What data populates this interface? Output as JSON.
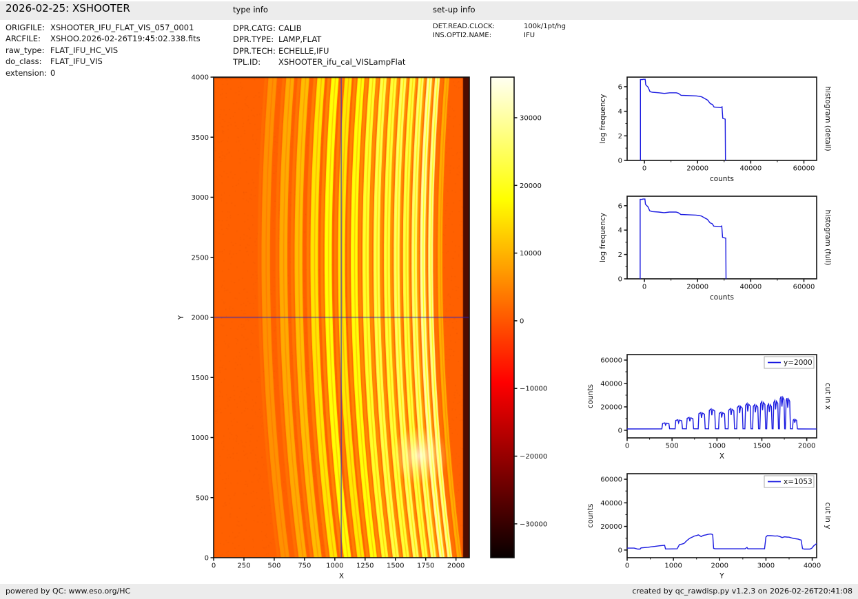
{
  "header": {
    "title": "2026-02-25: XSHOOTER",
    "type_info_title": "type info",
    "setup_info_title": "set-up info"
  },
  "file_info": {
    "rows": [
      {
        "label": "ORIGFILE:",
        "value": "XSHOOTER_IFU_FLAT_VIS_057_0001"
      },
      {
        "label": "ARCFILE:",
        "value": "XSHOO.2026-02-26T19:45:02.338.fits"
      },
      {
        "label": "raw_type:",
        "value": "FLAT_IFU_HC_VIS"
      },
      {
        "label": "do_class:",
        "value": "FLAT_IFU_VIS"
      },
      {
        "label": "extension:",
        "value": "0"
      }
    ]
  },
  "type_info": {
    "rows": [
      {
        "label": "DPR.CATG:",
        "value": "CALIB"
      },
      {
        "label": "DPR.TYPE:",
        "value": "LAMP,FLAT"
      },
      {
        "label": "DPR.TECH:",
        "value": "ECHELLE,IFU"
      },
      {
        "label": "TPL.ID:",
        "value": "XSHOOTER_ifu_cal_VISLampFlat"
      }
    ]
  },
  "setup_info": {
    "rows": [
      {
        "label": "DET.READ.CLOCK:",
        "value": "100k/1pt/hg"
      },
      {
        "label": "INS.OPTI2.NAME:",
        "value": "IFU"
      }
    ]
  },
  "footer": {
    "left": "powered by QC: www.eso.org/HC",
    "right": "created by qc_rawdisp.py v1.2.3 on 2026-02-26T20:41:08"
  },
  "colors": {
    "curve": "#1a1ae0",
    "crosshair": "#2020cc",
    "spine": "#111111",
    "bar_bg": "#ececec",
    "legend_edge": "#aaaaaa"
  },
  "chart_data": [
    {
      "id": "image",
      "type": "heatmap",
      "xlabel": "X",
      "ylabel": "Y",
      "xlim": [
        0,
        2110
      ],
      "ylim": [
        0,
        4000
      ],
      "xticks": [
        0,
        250,
        500,
        750,
        1000,
        1250,
        1500,
        1750,
        2000
      ],
      "yticks": [
        0,
        500,
        1000,
        1500,
        2000,
        2500,
        3000,
        3500,
        4000
      ],
      "crosshair": {
        "x": 1053,
        "y": 2000
      },
      "background_counts": 1100,
      "colormap": "hot",
      "vmin": -35000,
      "vmax": 36000,
      "curvature": {
        "vertex_y": 2500,
        "amplitude": 160
      },
      "orders": [
        {
          "x": 430,
          "peak": 6300,
          "hw": 38
        },
        {
          "x": 575,
          "peak": 9000,
          "hw": 36
        },
        {
          "x": 700,
          "peak": 11000,
          "hw": 35
        },
        {
          "x": 830,
          "peak": 15200,
          "hw": 34
        },
        {
          "x": 945,
          "peak": 18300,
          "hw": 33
        },
        {
          "x": 1055,
          "peak": 15500,
          "hw": 32
        },
        {
          "x": 1160,
          "peak": 18500,
          "hw": 31
        },
        {
          "x": 1255,
          "peak": 21000,
          "hw": 30
        },
        {
          "x": 1345,
          "peak": 23000,
          "hw": 29
        },
        {
          "x": 1430,
          "peak": 22000,
          "hw": 28
        },
        {
          "x": 1510,
          "peak": 24500,
          "hw": 27
        },
        {
          "x": 1585,
          "peak": 22500,
          "hw": 26
        },
        {
          "x": 1655,
          "peak": 25500,
          "hw": 25
        },
        {
          "x": 1725,
          "peak": 29000,
          "hw": 24
        },
        {
          "x": 1790,
          "peak": 27500,
          "hw": 23
        },
        {
          "x": 1868,
          "peak": 9400,
          "hw": 22
        }
      ],
      "edge_strip": {
        "x0": 2058,
        "x1": 2110
      },
      "bright_spot": {
        "x": 1700,
        "y": 850
      }
    },
    {
      "id": "cbar",
      "type": "colorbar",
      "colormap": "hot",
      "vmin": -35000,
      "vmax": 36000,
      "ticks": [
        30000,
        20000,
        10000,
        0,
        -10000,
        -20000,
        -30000
      ],
      "tick_labels": [
        "30000",
        "20000",
        "10000",
        "0",
        "−10000",
        "−20000",
        "−30000"
      ]
    },
    {
      "id": "hist1",
      "type": "line",
      "rlabel": "histogram (detail)",
      "xlabel": "counts",
      "ylabel": "log frequency",
      "xlim": [
        -6500,
        64800
      ],
      "ylim": [
        0,
        6.78
      ],
      "xticks": [
        0,
        20000,
        40000,
        60000
      ],
      "xminors": [
        10000,
        30000,
        50000
      ],
      "yticks": [
        0,
        2,
        4,
        6
      ],
      "yminors": [
        1,
        3,
        5
      ],
      "points": [
        [
          -1500,
          0
        ],
        [
          -1500,
          6.58
        ],
        [
          -700,
          6.58
        ],
        [
          -500,
          6.6
        ],
        [
          300,
          6.6
        ],
        [
          500,
          6.15
        ],
        [
          1400,
          5.95
        ],
        [
          2100,
          5.6
        ],
        [
          3000,
          5.55
        ],
        [
          5500,
          5.5
        ],
        [
          7500,
          5.45
        ],
        [
          9500,
          5.5
        ],
        [
          12000,
          5.5
        ],
        [
          12800,
          5.45
        ],
        [
          13800,
          5.3
        ],
        [
          16500,
          5.28
        ],
        [
          19500,
          5.25
        ],
        [
          20500,
          5.22
        ],
        [
          21500,
          5.18
        ],
        [
          22800,
          5.02
        ],
        [
          23800,
          4.9
        ],
        [
          24800,
          4.62
        ],
        [
          25600,
          4.55
        ],
        [
          26200,
          4.35
        ],
        [
          28700,
          4.3
        ],
        [
          29200,
          4.36
        ],
        [
          29500,
          3.42
        ],
        [
          30400,
          3.36
        ],
        [
          30500,
          0
        ]
      ]
    },
    {
      "id": "hist2",
      "type": "line",
      "rlabel": "histogram (full)",
      "xlabel": "counts",
      "ylabel": "log frequency",
      "xlim": [
        -6500,
        64800
      ],
      "ylim": [
        0,
        6.78
      ],
      "xticks": [
        0,
        20000,
        40000,
        60000
      ],
      "xminors": [
        10000,
        30000,
        50000
      ],
      "yticks": [
        0,
        2,
        4,
        6
      ],
      "yminors": [
        1,
        3,
        5
      ],
      "points": [
        [
          -1600,
          0
        ],
        [
          -1600,
          6.52
        ],
        [
          -800,
          6.52
        ],
        [
          -600,
          6.55
        ],
        [
          200,
          6.55
        ],
        [
          400,
          6.12
        ],
        [
          1300,
          5.92
        ],
        [
          2000,
          5.58
        ],
        [
          2900,
          5.52
        ],
        [
          5400,
          5.48
        ],
        [
          7400,
          5.43
        ],
        [
          9400,
          5.48
        ],
        [
          11900,
          5.48
        ],
        [
          12700,
          5.43
        ],
        [
          13700,
          5.28
        ],
        [
          16400,
          5.26
        ],
        [
          19400,
          5.23
        ],
        [
          20400,
          5.2
        ],
        [
          21400,
          5.16
        ],
        [
          22700,
          5.0
        ],
        [
          23700,
          4.88
        ],
        [
          24700,
          4.6
        ],
        [
          25500,
          4.53
        ],
        [
          26100,
          4.33
        ],
        [
          28600,
          4.28
        ],
        [
          29100,
          4.34
        ],
        [
          29400,
          3.4
        ],
        [
          30600,
          3.34
        ],
        [
          30700,
          0
        ]
      ]
    },
    {
      "id": "cutx",
      "type": "line",
      "rlabel": "cut in x",
      "xlabel": "X",
      "ylabel": "counts",
      "legend": "y=2000",
      "xlim": [
        0,
        2110
      ],
      "ylim": [
        -6500,
        64700
      ],
      "xticks": [
        0,
        500,
        1000,
        1500,
        2000
      ],
      "xminors": [
        250,
        750,
        1250,
        1750
      ],
      "yticks": [
        0,
        20000,
        40000,
        60000
      ],
      "yminors": [
        10000,
        30000,
        50000
      ],
      "points": [
        [
          0,
          1150
        ],
        [
          386,
          1200
        ],
        [
          387,
          1250
        ],
        [
          395,
          5860
        ],
        [
          420,
          6300
        ],
        [
          428,
          4410
        ],
        [
          438,
          6110
        ],
        [
          465,
          5670
        ],
        [
          473,
          1300
        ],
        [
          534,
          1250
        ],
        [
          542,
          8370
        ],
        [
          565,
          9000
        ],
        [
          573,
          6300
        ],
        [
          583,
          8730
        ],
        [
          608,
          8100
        ],
        [
          616,
          1300
        ],
        [
          660,
          1250
        ],
        [
          668,
          10230
        ],
        [
          690,
          11000
        ],
        [
          698,
          7700
        ],
        [
          708,
          10670
        ],
        [
          732,
          9900
        ],
        [
          740,
          1300
        ],
        [
          791,
          1250
        ],
        [
          799,
          14140
        ],
        [
          820,
          15200
        ],
        [
          828,
          10640
        ],
        [
          838,
          14740
        ],
        [
          861,
          13680
        ],
        [
          869,
          1300
        ],
        [
          907,
          1250
        ],
        [
          915,
          17020
        ],
        [
          935,
          18300
        ],
        [
          943,
          12810
        ],
        [
          953,
          17750
        ],
        [
          975,
          16470
        ],
        [
          983,
          1300
        ],
        [
          1018,
          1250
        ],
        [
          1026,
          14420
        ],
        [
          1045,
          15500
        ],
        [
          1053,
          10850
        ],
        [
          1063,
          15040
        ],
        [
          1084,
          13950
        ],
        [
          1092,
          1300
        ],
        [
          1124,
          1250
        ],
        [
          1132,
          17210
        ],
        [
          1150,
          18500
        ],
        [
          1158,
          12950
        ],
        [
          1168,
          17950
        ],
        [
          1188,
          16650
        ],
        [
          1196,
          1300
        ],
        [
          1220,
          1250
        ],
        [
          1228,
          19530
        ],
        [
          1245,
          21000
        ],
        [
          1253,
          14700
        ],
        [
          1263,
          20370
        ],
        [
          1282,
          18900
        ],
        [
          1290,
          1300
        ],
        [
          1311,
          1250
        ],
        [
          1319,
          21390
        ],
        [
          1335,
          23000
        ],
        [
          1343,
          16100
        ],
        [
          1353,
          22310
        ],
        [
          1371,
          20700
        ],
        [
          1379,
          1300
        ],
        [
          1397,
          1250
        ],
        [
          1405,
          20460
        ],
        [
          1420,
          22000
        ],
        [
          1428,
          15400
        ],
        [
          1438,
          21340
        ],
        [
          1455,
          19800
        ],
        [
          1463,
          1300
        ],
        [
          1478,
          1250
        ],
        [
          1486,
          22790
        ],
        [
          1500,
          24500
        ],
        [
          1508,
          17150
        ],
        [
          1518,
          23770
        ],
        [
          1534,
          22050
        ],
        [
          1542,
          1300
        ],
        [
          1554,
          1250
        ],
        [
          1562,
          20930
        ],
        [
          1575,
          22500
        ],
        [
          1583,
          15750
        ],
        [
          1593,
          21830
        ],
        [
          1606,
          20250
        ],
        [
          1614,
          1300
        ],
        [
          1625,
          1250
        ],
        [
          1633,
          23720
        ],
        [
          1645,
          25500
        ],
        [
          1653,
          17850
        ],
        [
          1663,
          24740
        ],
        [
          1677,
          22950
        ],
        [
          1685,
          1300
        ],
        [
          1696,
          1250
        ],
        [
          1704,
          26970
        ],
        [
          1715,
          29000
        ],
        [
          1723,
          20300
        ],
        [
          1733,
          28130
        ],
        [
          1746,
          26100
        ],
        [
          1754,
          1300
        ],
        [
          1762,
          1250
        ],
        [
          1770,
          25580
        ],
        [
          1780,
          27500
        ],
        [
          1788,
          19250
        ],
        [
          1798,
          26680
        ],
        [
          1810,
          24750
        ],
        [
          1818,
          1300
        ],
        [
          1841,
          1250
        ],
        [
          1849,
          8740
        ],
        [
          1858,
          9400
        ],
        [
          1866,
          6580
        ],
        [
          1876,
          9120
        ],
        [
          1887,
          8460
        ],
        [
          1895,
          1300
        ],
        [
          1905,
          1150
        ],
        [
          2110,
          1100
        ]
      ]
    },
    {
      "id": "cuty",
      "type": "line",
      "rlabel": "cut in y",
      "xlabel": "Y",
      "ylabel": "counts",
      "legend": "x=1053",
      "xlim": [
        0,
        4096
      ],
      "ylim": [
        -6500,
        64700
      ],
      "xticks": [
        0,
        1000,
        2000,
        3000,
        4000
      ],
      "xminors": [
        500,
        1500,
        2500,
        3500
      ],
      "yticks": [
        0,
        20000,
        40000,
        60000
      ],
      "yminors": [
        10000,
        30000,
        50000
      ],
      "points": [
        [
          0,
          1600
        ],
        [
          150,
          1600
        ],
        [
          180,
          1300
        ],
        [
          230,
          800
        ],
        [
          280,
          800
        ],
        [
          300,
          1800
        ],
        [
          380,
          2100
        ],
        [
          450,
          2300
        ],
        [
          520,
          2700
        ],
        [
          600,
          3100
        ],
        [
          700,
          3600
        ],
        [
          780,
          3900
        ],
        [
          810,
          4000
        ],
        [
          830,
          900
        ],
        [
          900,
          900
        ],
        [
          1080,
          1000
        ],
        [
          1100,
          2500
        ],
        [
          1130,
          4600
        ],
        [
          1180,
          5000
        ],
        [
          1230,
          5600
        ],
        [
          1270,
          7200
        ],
        [
          1300,
          8300
        ],
        [
          1340,
          9600
        ],
        [
          1380,
          10500
        ],
        [
          1420,
          11200
        ],
        [
          1450,
          11800
        ],
        [
          1500,
          12300
        ],
        [
          1540,
          12800
        ],
        [
          1560,
          12400
        ],
        [
          1600,
          11400
        ],
        [
          1650,
          12400
        ],
        [
          1700,
          12800
        ],
        [
          1750,
          13300
        ],
        [
          1800,
          13600
        ],
        [
          1830,
          13400
        ],
        [
          1850,
          12800
        ],
        [
          1870,
          1400
        ],
        [
          1900,
          1000
        ],
        [
          2550,
          1000
        ],
        [
          2590,
          2200
        ],
        [
          2610,
          1000
        ],
        [
          2970,
          1000
        ],
        [
          3000,
          11000
        ],
        [
          3030,
          12200
        ],
        [
          3100,
          12200
        ],
        [
          3200,
          11800
        ],
        [
          3250,
          12000
        ],
        [
          3300,
          11400
        ],
        [
          3350,
          10600
        ],
        [
          3400,
          11200
        ],
        [
          3450,
          11000
        ],
        [
          3500,
          10900
        ],
        [
          3550,
          10300
        ],
        [
          3600,
          9800
        ],
        [
          3650,
          9500
        ],
        [
          3700,
          9200
        ],
        [
          3730,
          8800
        ],
        [
          3760,
          8500
        ],
        [
          3790,
          1200
        ],
        [
          3830,
          800
        ],
        [
          3950,
          800
        ],
        [
          3990,
          1500
        ],
        [
          4030,
          3500
        ],
        [
          4096,
          5500
        ]
      ]
    }
  ]
}
